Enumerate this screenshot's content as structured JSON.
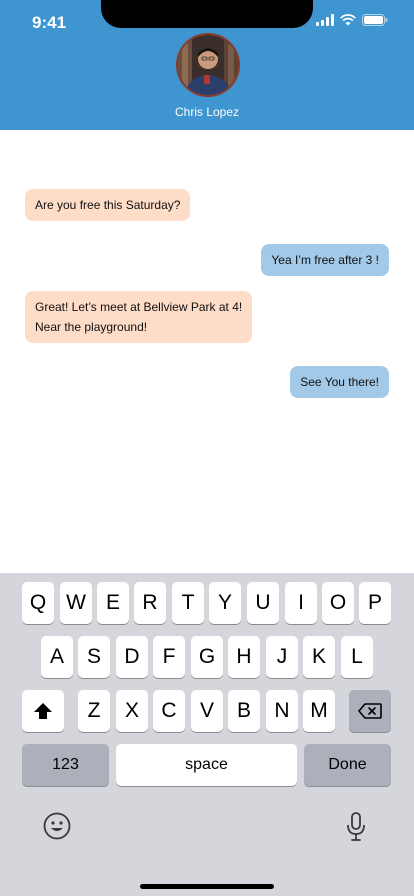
{
  "status_bar": {
    "time": "9:41"
  },
  "contact": {
    "name": "Chris Lopez"
  },
  "messages": [
    {
      "direction": "received",
      "text": "Are you free this Saturday?"
    },
    {
      "direction": "sent",
      "text": "Yea I’m free after 3 !"
    },
    {
      "direction": "received",
      "line1": "Great! Let’s meet at Bellview Park at 4!",
      "line2": "Near the playground!"
    },
    {
      "direction": "sent",
      "text": "See You there!"
    }
  ],
  "keyboard": {
    "row1": [
      "Q",
      "W",
      "E",
      "R",
      "T",
      "Y",
      "U",
      "I",
      "O",
      "P"
    ],
    "row2": [
      "A",
      "S",
      "D",
      "F",
      "G",
      "H",
      "J",
      "K",
      "L"
    ],
    "row3": [
      "Z",
      "X",
      "C",
      "V",
      "B",
      "N",
      "M"
    ],
    "numbers_label": "123",
    "space_label": "space",
    "done_label": "Done"
  },
  "colors": {
    "header_bg": "#3f95d0",
    "received_bubble": "#fddcc8",
    "sent_bubble": "#a3c9e8",
    "keyboard_bg": "#d4d6db"
  },
  "icons": [
    "signal-icon",
    "wifi-icon",
    "battery-icon",
    "shift-icon",
    "backspace-icon",
    "emoji-icon",
    "microphone-icon"
  ]
}
